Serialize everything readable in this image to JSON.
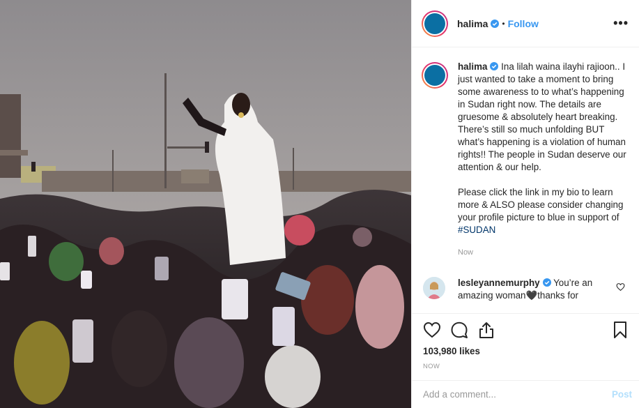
{
  "post": {
    "username": "halima",
    "separator": "•",
    "follow_label": "Follow",
    "more_label": "•••",
    "caption_text": "Ina lilah waina ilayhi rajioon.. I just wanted to take a moment to bring some awareness to to what’s happening in Sudan right now. The details are gruesome & absolutely heart breaking. There’s still so much unfolding BUT what’s happening is a violation of human rights!! The people in Sudan deserve our attention & our help.",
    "caption_text_2": "Please click the link in my bio to learn more & ALSO please consider changing your profile picture to blue in support of",
    "hashtag": "#SUDAN",
    "caption_time": "Now"
  },
  "comments": [
    {
      "username": "lesleyannemurphy",
      "text": "You’re an amazing woman🖤thanks for"
    }
  ],
  "engagement": {
    "likes": "103,980 likes",
    "posted_time": "NOW"
  },
  "add_comment": {
    "placeholder": "Add a comment...",
    "post_label": "Post"
  },
  "icons": {
    "verified": "verified-badge-icon",
    "like": "heart-icon",
    "comment": "comment-bubble-icon",
    "share": "share-icon",
    "save": "bookmark-icon",
    "comment_like": "small-heart-icon"
  },
  "colors": {
    "accent": "#3897f0",
    "avatar": "#0b6fa3",
    "post_disabled": "#b2dffc",
    "hashtag": "#003569"
  }
}
